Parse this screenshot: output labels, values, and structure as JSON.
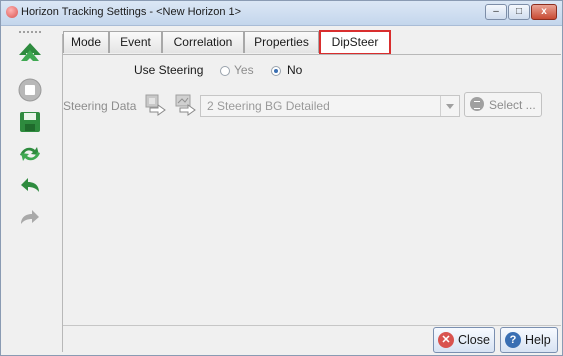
{
  "window": {
    "title": "Horizon Tracking Settings - <New Horizon 1>",
    "controls": {
      "minimize": "–",
      "maximize": "□",
      "close": "x"
    }
  },
  "toolbar": {
    "icons": [
      "up-arrow-icon",
      "stop-icon",
      "save-icon",
      "transfer-icon",
      "undo-icon",
      "redo-icon"
    ]
  },
  "tabs": [
    {
      "label": "Mode",
      "active": false
    },
    {
      "label": "Event",
      "active": false
    },
    {
      "label": "Correlation",
      "active": false
    },
    {
      "label": "Properties",
      "active": false
    },
    {
      "label": "DipSteer",
      "active": true
    }
  ],
  "dipsteer": {
    "use_steering_label": "Use Steering",
    "option_yes": "Yes",
    "option_no": "No",
    "selected": "No",
    "steering_data_label": "Steering Data",
    "steering_value": "2 Steering BG Detailed",
    "select_label": "Select ..."
  },
  "footer": {
    "close_label": "Close",
    "help_label": "Help"
  },
  "colors": {
    "active_tab_border": "#d92e2e",
    "close_icon": "#d9534f",
    "help_icon": "#3a6fb3",
    "toolbar_green": "#2e8b3e"
  }
}
